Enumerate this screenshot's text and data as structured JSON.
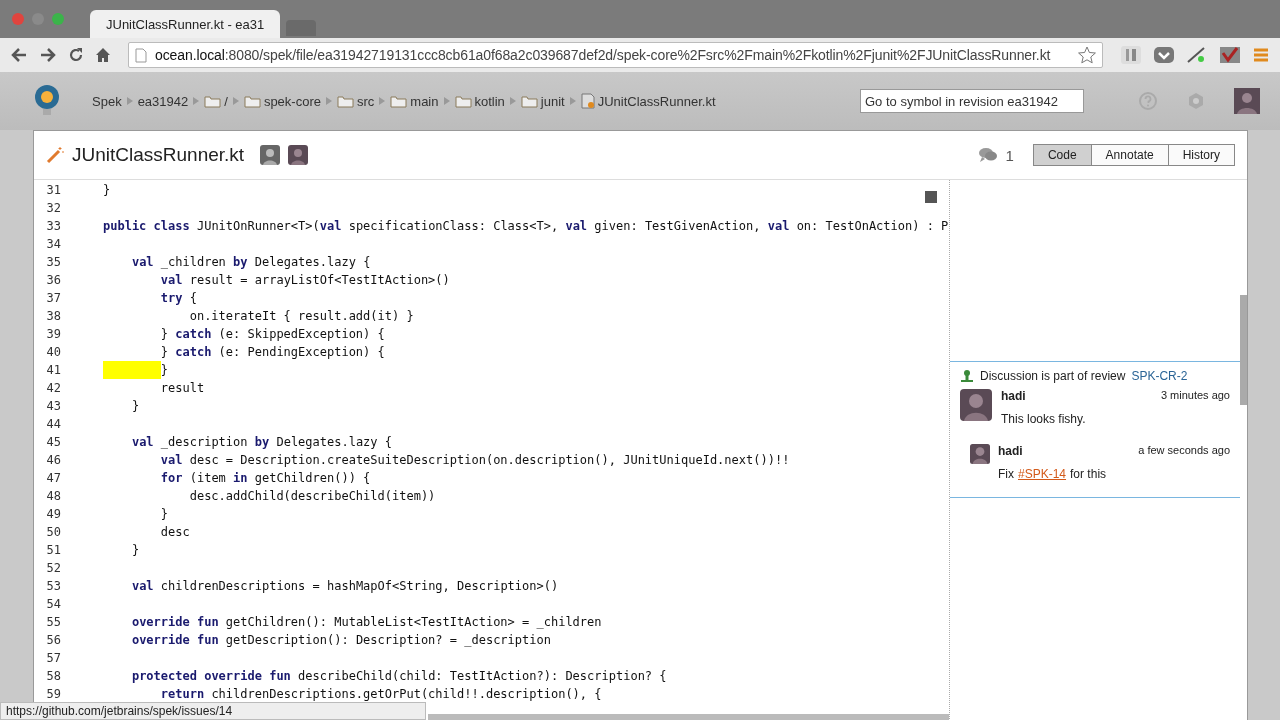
{
  "browser": {
    "tab_title": "JUnitClassRunner.kt - ea31",
    "url_host": "ocean.local",
    "url_rest": ":8080/spek/file/ea31942719131ccc8cb61a0f68a2c039687def2d/spek-core%2Fsrc%2Fmain%2Fkotlin%2Fjunit%2FJUnitClassRunner.kt",
    "status_url": "https://github.com/jetbrains/spek/issues/14"
  },
  "header": {
    "breadcrumbs": [
      {
        "kind": "text",
        "label": "Spek"
      },
      {
        "kind": "text",
        "label": "ea31942"
      },
      {
        "kind": "folder",
        "label": "/"
      },
      {
        "kind": "folder",
        "label": "spek-core"
      },
      {
        "kind": "folder",
        "label": "src"
      },
      {
        "kind": "folder",
        "label": "main"
      },
      {
        "kind": "folder",
        "label": "kotlin"
      },
      {
        "kind": "folder",
        "label": "junit"
      },
      {
        "kind": "file",
        "label": "JUnitClassRunner.kt"
      }
    ],
    "search": {
      "placeholder": "Go to symbol in revision ea31942"
    }
  },
  "file": {
    "name": "JUnitClassRunner.kt",
    "comment_count": "1",
    "views": [
      {
        "label": "Code",
        "selected": true
      },
      {
        "label": "Annotate",
        "selected": false
      },
      {
        "label": "History",
        "selected": false
      }
    ]
  },
  "code": [
    {
      "number": "31",
      "text": "}",
      "highlighted": false
    },
    {
      "number": "32",
      "highlighted": false
    },
    {
      "number": "33",
      "text": "**public class** JUnitOnRunner<T>(**val** specificationClass: Class<T>, **val** given: TestGivenAction, **val** on: TestOnAction) : P",
      "highlighted": false
    },
    {
      "number": "34",
      "highlighted": false
    },
    {
      "number": "35",
      "text": "    **val** _children **by** Delegates.lazy {",
      "highlighted": false
    },
    {
      "number": "36",
      "text": "        **val** result = arrayListOf<TestItAction>()",
      "highlighted": false
    },
    {
      "number": "37",
      "text": "        **try** {",
      "highlighted": false
    },
    {
      "number": "38",
      "text": "            on.iterateIt { result.add(it) }",
      "highlighted": false
    },
    {
      "number": "39",
      "text": "        } **catch** (e: SkippedException) {",
      "highlighted": false
    },
    {
      "number": "40",
      "text": "        } **catch** (e: PendingException) {",
      "highlighted": false
    },
    {
      "number": "41",
      "text": "        }",
      "highlighted": true
    },
    {
      "number": "42",
      "text": "        result",
      "highlighted": false
    },
    {
      "number": "43",
      "text": "    }",
      "highlighted": false
    },
    {
      "number": "44",
      "highlighted": false
    },
    {
      "number": "45",
      "text": "    **val** _description **by** Delegates.lazy {",
      "highlighted": false
    },
    {
      "number": "46",
      "text": "        **val** desc = Description.createSuiteDescription(on.description(), JUnitUniqueId.next())!!",
      "highlighted": false
    },
    {
      "number": "47",
      "text": "        **for** (item **in** getChildren()) {",
      "highlighted": false
    },
    {
      "number": "48",
      "text": "            desc.addChild(describeChild(item))",
      "highlighted": false
    },
    {
      "number": "49",
      "text": "        }",
      "highlighted": false
    },
    {
      "number": "50",
      "text": "        desc",
      "highlighted": false
    },
    {
      "number": "51",
      "text": "    }",
      "highlighted": false
    },
    {
      "number": "52",
      "highlighted": false
    },
    {
      "number": "53",
      "text": "    **val** childrenDescriptions = hashMapOf<String, Description>()",
      "highlighted": false
    },
    {
      "number": "54",
      "highlighted": false
    },
    {
      "number": "55",
      "text": "    **override fun** getChildren(): MutableList<TestItAction> = _children",
      "highlighted": false
    },
    {
      "number": "56",
      "text": "    **override fun** getDescription(): Description? = _description",
      "highlighted": false
    },
    {
      "number": "57",
      "highlighted": false
    },
    {
      "number": "58",
      "text": "    **protected override fun** describeChild(child: TestItAction?): Description? {",
      "highlighted": false
    },
    {
      "number": "59",
      "text": "        **return** childrenDescriptions.getOrPut(child!!.description(), {",
      "highlighted": false
    }
  ],
  "discussion": {
    "intro": "Discussion is part of review",
    "review": "SPK-CR-2",
    "comments": [
      {
        "kind": "comment",
        "author": "hadi",
        "time": "3 minutes ago",
        "text": "This looks fishy."
      },
      {
        "kind": "reply",
        "author": "hadi",
        "time": "a few seconds ago",
        "text": "Fix",
        "link": "#SPK-14",
        "after": "for this"
      }
    ]
  }
}
